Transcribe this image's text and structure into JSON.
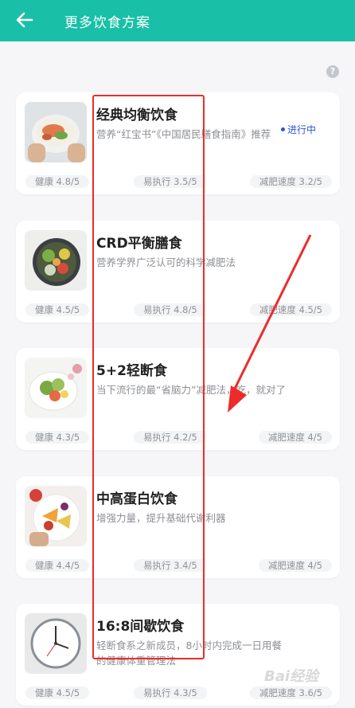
{
  "header": {
    "title": "更多饮食方案"
  },
  "help": {
    "label": "?"
  },
  "cards": [
    {
      "title": "经典均衡饮食",
      "desc": "营养“红宝书”《中国居民膳食指南》推荐",
      "status": "进行中",
      "health": "健康 4.8/5",
      "ease": "易执行 3.5/5",
      "speed": "减肥速度 3.2/5"
    },
    {
      "title": "CRD平衡膳食",
      "desc": "营养学界广泛认可的科学减肥法",
      "status": "",
      "health": "健康 4.5/5",
      "ease": "易执行 4.8/5",
      "speed": "减肥速度 4.5/5"
    },
    {
      "title": "5+2轻断食",
      "desc": "当下流行的最“省脑力”减肥法，吃，就对了",
      "status": "",
      "health": "健康 4.3/5",
      "ease": "易执行 4.2/5",
      "speed": "减肥速度 4/5"
    },
    {
      "title": "中高蛋白饮食",
      "desc": "增强力量，提升基础代谢利器",
      "status": "",
      "health": "健康 4.4/5",
      "ease": "易执行 3.4/5",
      "speed": "减肥速度 4/5"
    },
    {
      "title": "16:8间歇饮食",
      "desc": "轻断食系之新成员，8小时内完成一日用餐的健康体重管理法",
      "status": "",
      "health": "健康 4.5/5",
      "ease": "易执行 4.3/5",
      "speed": "减肥速度 3.6/5"
    }
  ],
  "watermark": "Bai经验",
  "colors": {
    "header": "#19bfa6",
    "status": "#2b55d8",
    "highlight": "#ee2b2b"
  }
}
